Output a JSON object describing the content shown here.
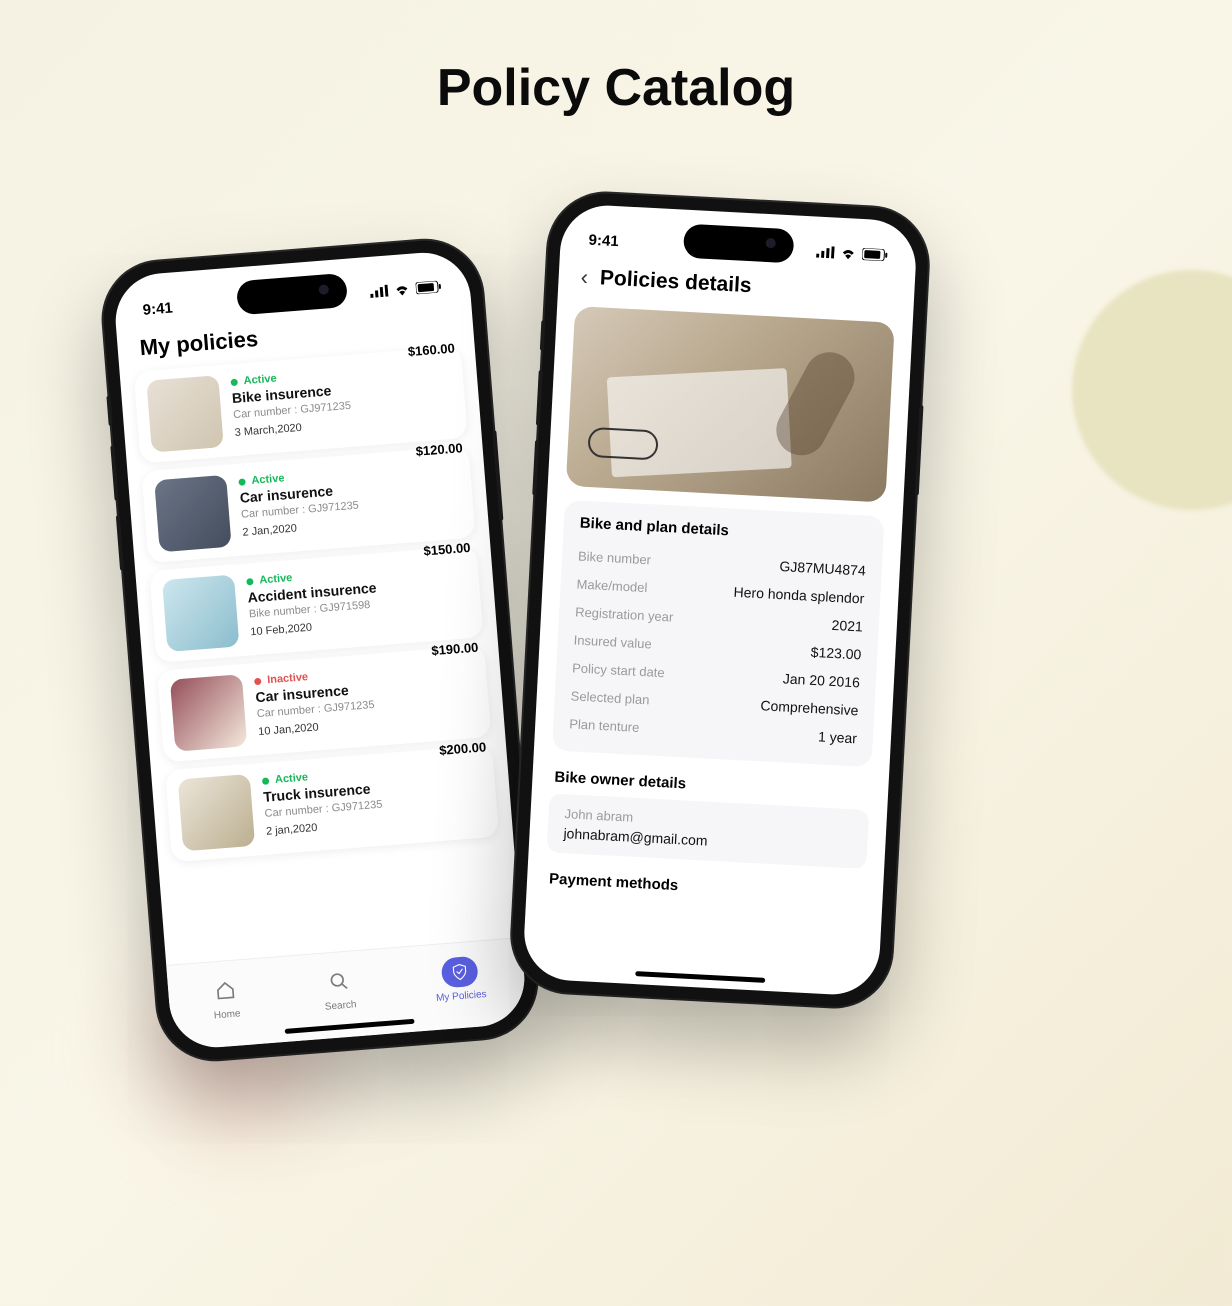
{
  "page_title": "Policy Catalog",
  "status": {
    "time": "9:41"
  },
  "screenA": {
    "heading": "My policies",
    "policies": [
      {
        "status": "Active",
        "status_key": "active",
        "name": "Bike insurence",
        "sub": "Car number : GJ971235",
        "date": "3 March,2020",
        "price": "$160.00",
        "thumb": "t-bike"
      },
      {
        "status": "Active",
        "status_key": "active",
        "name": "Car insurence",
        "sub": "Car number : GJ971235",
        "date": "2 Jan,2020",
        "price": "$120.00",
        "thumb": "t-car"
      },
      {
        "status": "Active",
        "status_key": "active",
        "name": "Accident insurence",
        "sub": "Bike number : GJ971598",
        "date": "10 Feb,2020",
        "price": "$150.00",
        "thumb": "t-acc"
      },
      {
        "status": "Inactive",
        "status_key": "inactive",
        "name": "Car insurence",
        "sub": "Car number : GJ971235",
        "date": "10 Jan,2020",
        "price": "$190.00",
        "thumb": "t-car2"
      },
      {
        "status": "Active",
        "status_key": "active",
        "name": "Truck insurence",
        "sub": "Car number : GJ971235",
        "date": "2 jan,2020",
        "price": "$200.00",
        "thumb": "t-truck"
      }
    ],
    "nav": {
      "home": "Home",
      "search": "Search",
      "policies": "My Policies"
    }
  },
  "screenB": {
    "title": "Policies details",
    "card_heading": "Bike and plan details",
    "rows": [
      {
        "label": "Bike number",
        "value": "GJ87MU4874"
      },
      {
        "label": "Make/model",
        "value": "Hero honda splendor"
      },
      {
        "label": "Registration year",
        "value": "2021"
      },
      {
        "label": "Insured value",
        "value": "$123.00"
      },
      {
        "label": "Policy start date",
        "value": "Jan 20 2016"
      },
      {
        "label": "Selected plan",
        "value": "Comprehensive"
      },
      {
        "label": "Plan tenture",
        "value": "1 year"
      }
    ],
    "owner_heading": "Bike owner details",
    "owner": {
      "name": "John abram",
      "email": "johnabram@gmail.com"
    },
    "payment_heading": "Payment methods"
  }
}
